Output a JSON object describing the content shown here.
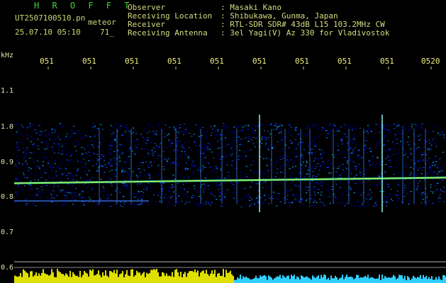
{
  "header": {
    "brand": "H R O F F T",
    "file_name": "UT2507100510.pn",
    "meteor_label": "meteor",
    "datetime": "25.07.10 05:10",
    "frame_number": "71_"
  },
  "info": [
    {
      "key": "Observer",
      "value": ": Masaki Kano"
    },
    {
      "key": "Receiving Location",
      "value": ": Shibukawa, Gunma, Japan"
    },
    {
      "key": "Receiver",
      "value": ": RTL-SDR SDR# 43dB L15 103.2MHz CW"
    },
    {
      "key": "Receiving Antenna",
      "value": ": 3el Yagi(V) Az 330 for Vladivostok"
    }
  ],
  "axis": {
    "unit": "kHz",
    "time_ticks": [
      "051",
      "051",
      "051",
      "051",
      "051",
      "051",
      "051",
      "051",
      "051",
      "0520"
    ],
    "freq_ticks": [
      "1.1",
      "1.0",
      "0.9",
      "0.8",
      "0.7",
      "0.6"
    ]
  },
  "colors": {
    "background": "#000000",
    "noise_low": "#0000c0",
    "noise_mid": "#00c0ff",
    "echo_line": "#ffff60",
    "level_bars": "#e0e000"
  }
}
